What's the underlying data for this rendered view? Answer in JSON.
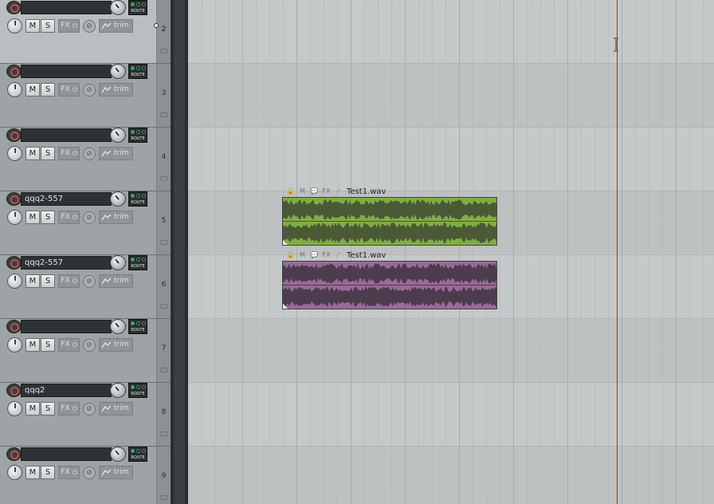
{
  "app": "REAPER",
  "colors": {
    "item_green": "#7fae43",
    "item_green_wave": "#4a5a36",
    "item_purple": "#9a6a9a",
    "item_purple_wave": "#4d3c4d",
    "edit_cursor": "#a0363a"
  },
  "icons": {
    "record_arm": "record-arm-icon",
    "volume": "volume-knob",
    "pan": "pan-knob",
    "route": "route-icon",
    "fx_power": "power-icon",
    "phase": "phase-invert-icon",
    "envelope": "envelope-icon",
    "folder": "folder-icon",
    "lock": "lock-icon",
    "mute": "mute-icon",
    "notes": "notes-icon",
    "item_fx": "fx-icon",
    "item_envelope": "envelope-icon",
    "text_cursor": "i-beam-cursor-icon"
  },
  "tcp_labels": {
    "mute": "M",
    "solo": "S",
    "fx": "FX",
    "power": "⏻",
    "phase": "⊘",
    "trim": "trim",
    "route": "ROUTE"
  },
  "tracks": [
    {
      "number": "2",
      "name": "",
      "selected": true
    },
    {
      "number": "3",
      "name": "",
      "selected": false
    },
    {
      "number": "4",
      "name": "",
      "selected": false
    },
    {
      "number": "5",
      "name": "qqq2-557",
      "selected": false
    },
    {
      "number": "6",
      "name": "qqq2-557",
      "selected": false
    },
    {
      "number": "7",
      "name": "",
      "selected": false
    },
    {
      "number": "8",
      "name": "qqq2",
      "selected": false
    },
    {
      "number": "9",
      "name": "",
      "selected": false
    }
  ],
  "items": [
    {
      "track": "5",
      "name": "Test1.wav",
      "color": "green",
      "icons": [
        "🔒",
        "M",
        "💬",
        "FX",
        "⟋"
      ]
    },
    {
      "track": "6",
      "name": "Test1.wav",
      "color": "purple",
      "icons": [
        "🔒",
        "M",
        "💬",
        "FX",
        "⟋"
      ]
    }
  ]
}
